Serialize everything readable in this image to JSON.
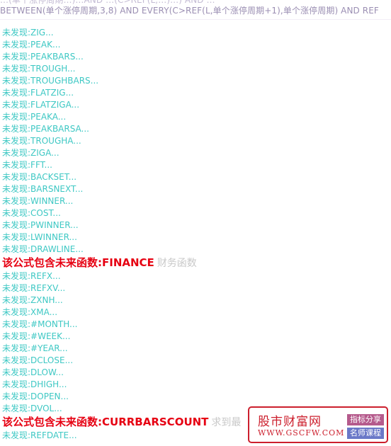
{
  "code": {
    "line1": "…(单个涨停周期…)…AND …(C>REF(L,…)…) AND …",
    "line2": "BETWEEN(单个涨停周期,3,8) AND EVERY(C>REF(L,单个涨停周期+1),单个涨停周期) AND REF"
  },
  "results": [
    {
      "kind": "missing",
      "text": "未发现:ZIG..."
    },
    {
      "kind": "missing",
      "text": "未发现:PEAK..."
    },
    {
      "kind": "missing",
      "text": "未发现:PEAKBARS..."
    },
    {
      "kind": "missing",
      "text": "未发现:TROUGH..."
    },
    {
      "kind": "missing",
      "text": "未发现:TROUGHBARS..."
    },
    {
      "kind": "missing",
      "text": "未发现:FLATZIG..."
    },
    {
      "kind": "missing",
      "text": "未发现:FLATZIGA..."
    },
    {
      "kind": "missing",
      "text": "未发现:PEAKA..."
    },
    {
      "kind": "missing",
      "text": "未发现:PEAKBARSA..."
    },
    {
      "kind": "missing",
      "text": "未发现:TROUGHA..."
    },
    {
      "kind": "missing",
      "text": "未发现:ZIGA..."
    },
    {
      "kind": "missing",
      "text": "未发现:FFT..."
    },
    {
      "kind": "missing",
      "text": "未发现:BACKSET..."
    },
    {
      "kind": "missing",
      "text": "未发现:BARSNEXT..."
    },
    {
      "kind": "missing",
      "text": "未发现:WINNER..."
    },
    {
      "kind": "missing",
      "text": "未发现:COST..."
    },
    {
      "kind": "missing",
      "text": "未发现:PWINNER..."
    },
    {
      "kind": "missing",
      "text": "未发现:LWINNER..."
    },
    {
      "kind": "missing",
      "text": "未发现:DRAWLINE..."
    },
    {
      "kind": "warning",
      "text": "该公式包含未来函数:FINANCE",
      "note": "财务函数"
    },
    {
      "kind": "missing",
      "text": "未发现:REFX..."
    },
    {
      "kind": "missing",
      "text": "未发现:REFXV..."
    },
    {
      "kind": "missing",
      "text": "未发现:ZXNH..."
    },
    {
      "kind": "missing",
      "text": "未发现:XMA..."
    },
    {
      "kind": "missing",
      "text": "未发现:#MONTH..."
    },
    {
      "kind": "missing",
      "text": "未发现:#WEEK..."
    },
    {
      "kind": "missing",
      "text": "未发现:#YEAR..."
    },
    {
      "kind": "missing",
      "text": "未发现:DCLOSE..."
    },
    {
      "kind": "missing",
      "text": "未发现:DLOW..."
    },
    {
      "kind": "missing",
      "text": "未发现:DHIGH..."
    },
    {
      "kind": "missing",
      "text": "未发现:DOPEN..."
    },
    {
      "kind": "missing",
      "text": "未发现:DVOL..."
    },
    {
      "kind": "warning",
      "text": "该公式包含未来函数:CURRBARSCOUNT",
      "note": "求到最"
    },
    {
      "kind": "missing",
      "text": "未发现:REFDATE..."
    }
  ],
  "watermark": {
    "name": "股市财富网",
    "url": "WWW.GSCFW.COM",
    "tag1": "指标分享",
    "tag2": "名师课程"
  },
  "colors": {
    "missing": "#3ec8c4",
    "warning": "#e60012",
    "brand": "#cc1f2d"
  }
}
